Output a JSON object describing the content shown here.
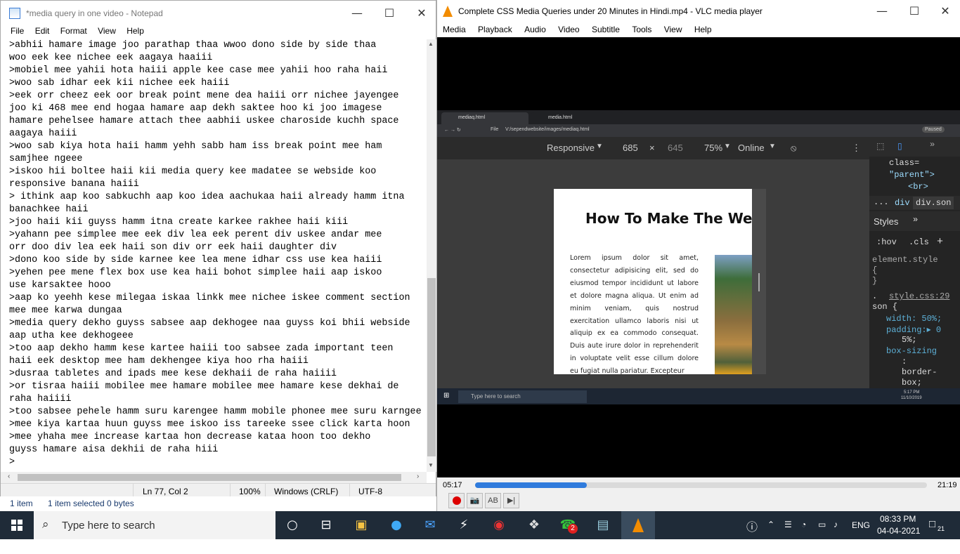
{
  "notepad": {
    "title": "*media query in one video - Notepad",
    "menu": [
      "File",
      "Edit",
      "Format",
      "View",
      "Help"
    ],
    "content": ">abhii hamare image joo parathap thaa wwoo dono side by side thaa\nwoo eek kee nichee eek aagaya haaiii\n>mobiel mee yahii hota haiii apple kee case mee yahii hoo raha haii\n>woo sab idhar eek kii nichee eek haiii\n>eek orr cheez eek oor break point mene dea haiii orr nichee jayengee\njoo ki 468 mee end hogaa hamare aap dekh saktee hoo ki joo imagese\nhamare pehelsee hamare attach thee aabhii uskee charoside kuchh space\naagaya haiii\n>woo sab kiya hota haii hamm yehh sabb ham iss break point mee ham\nsamjhee ngeee\n>iskoo hii boltee haii kii media query kee madatee se webside koo\nresponsive banana haiii\n> ithink aap koo sabkuchh aap koo idea aachukaa haii already hamm itna\nbanachkee haii\n>joo haii kii guyss hamm itna create karkee rakhee haii kiii\n>yahann pee simplee mee eek div lea eek perent div uskee andar mee\norr doo div lea eek haii son div orr eek haii daughter div\n>dono koo side by side karnee kee lea mene idhar css use kea haiii\n>yehen pee mene flex box use kea haii bohot simplee haii aap iskoo\nuse karsaktee hooo\n>aap ko yeehh kese milegaa iskaa linkk mee nichee iskee comment section\nmee mee karwa dungaa\n>media query dekho guyss sabsee aap dekhogee naa guyss koi bhii webside\naap utha kee dekhogeee\n>too aap dekho hamm kese kartee haiii too sabsee zada important teen\nhaii eek desktop mee ham dekhengee kiya hoo rha haiii\n>dusraa tabletes and ipads mee kese dekhaii de raha haiiii\n>or tisraa haiii mobilee mee hamare mobilee mee hamare kese dekhai de\nraha haiiii\n>too sabsee pehele hamm suru karengee hamm mobile phonee mee suru karngee\n>mee kiya kartaa huun guyss mee iskoo iss tareeke ssee click karta hoon\n>mee yhaha mee increase kartaa hon decrease kataa hoon too dekho\nguyss hamare aisa dekhii de raha hiii\n>",
    "status": {
      "position": "Ln 77, Col 2",
      "zoom": "100%",
      "eol": "Windows (CRLF)",
      "encoding": "UTF-8"
    }
  },
  "explorer_status": {
    "count": "1 item",
    "selected": "1 item selected  0 bytes"
  },
  "vlc": {
    "title": "Complete CSS Media Queries under 20 Minutes in Hindi.mp4 - VLC media player",
    "menu": [
      "Media",
      "Playback",
      "Audio",
      "Video",
      "Subtitle",
      "Tools",
      "View",
      "Help"
    ],
    "elapsed": "05:17",
    "total": "21:19",
    "progress": 0.248
  },
  "video": {
    "tabs": [
      "mediaq.html",
      "media.html"
    ],
    "url": "V:/sependwebsite/images/mediaq.html",
    "file_label": "File",
    "paused_label": "Paused",
    "device": "Responsive",
    "width": "685",
    "times": "×",
    "height": "645",
    "zoom": "75%",
    "network": "Online",
    "page_heading": "How To Make The Websi",
    "page_text": "Lorem ipsum dolor sit amet, consectetur adipisicing elit, sed do eiusmod tempor incididunt ut labore et dolore magna aliqua. Ut enim ad minim veniam, quis nostrud exercitation ullamco laboris nisi ut aliquip ex ea commodo consequat. Duis aute irure dolor in reprehenderit in voluptate velit esse cillum dolore eu fugiat nulla pariatur. Excepteur",
    "devtools": {
      "line1": "class=",
      "line2": "\"parent\">",
      "line3": "<br>",
      "crumb_dots": "...",
      "crumb_div": "div",
      "crumb_son": "div.son",
      "styles_tab": "Styles",
      "more": "»",
      "hov": ":hov",
      "cls": ".cls",
      "plus": "+",
      "element_style": "element.style",
      "brace_open": "{",
      "brace_close": "}",
      "dot": ".",
      "source": "style.css:29",
      "selector": "son {",
      "width_prop": "width: 50%;",
      "padding_prop": "padding:▸ 0",
      "padding_cont": "5%;",
      "box_prop": "box-sizing",
      "colon": ":",
      "box_val": "border-",
      "box_val2": "box;"
    },
    "inner_search": "Type here to search",
    "inner_time": "5:17 PM",
    "inner_date": "11/10/2019"
  },
  "taskbar": {
    "search_placeholder": "Type here to search",
    "whatsapp_badge": "2",
    "lang": "ENG",
    "time": "08:33 PM",
    "date": "04-04-2021",
    "notif_count": "21"
  }
}
